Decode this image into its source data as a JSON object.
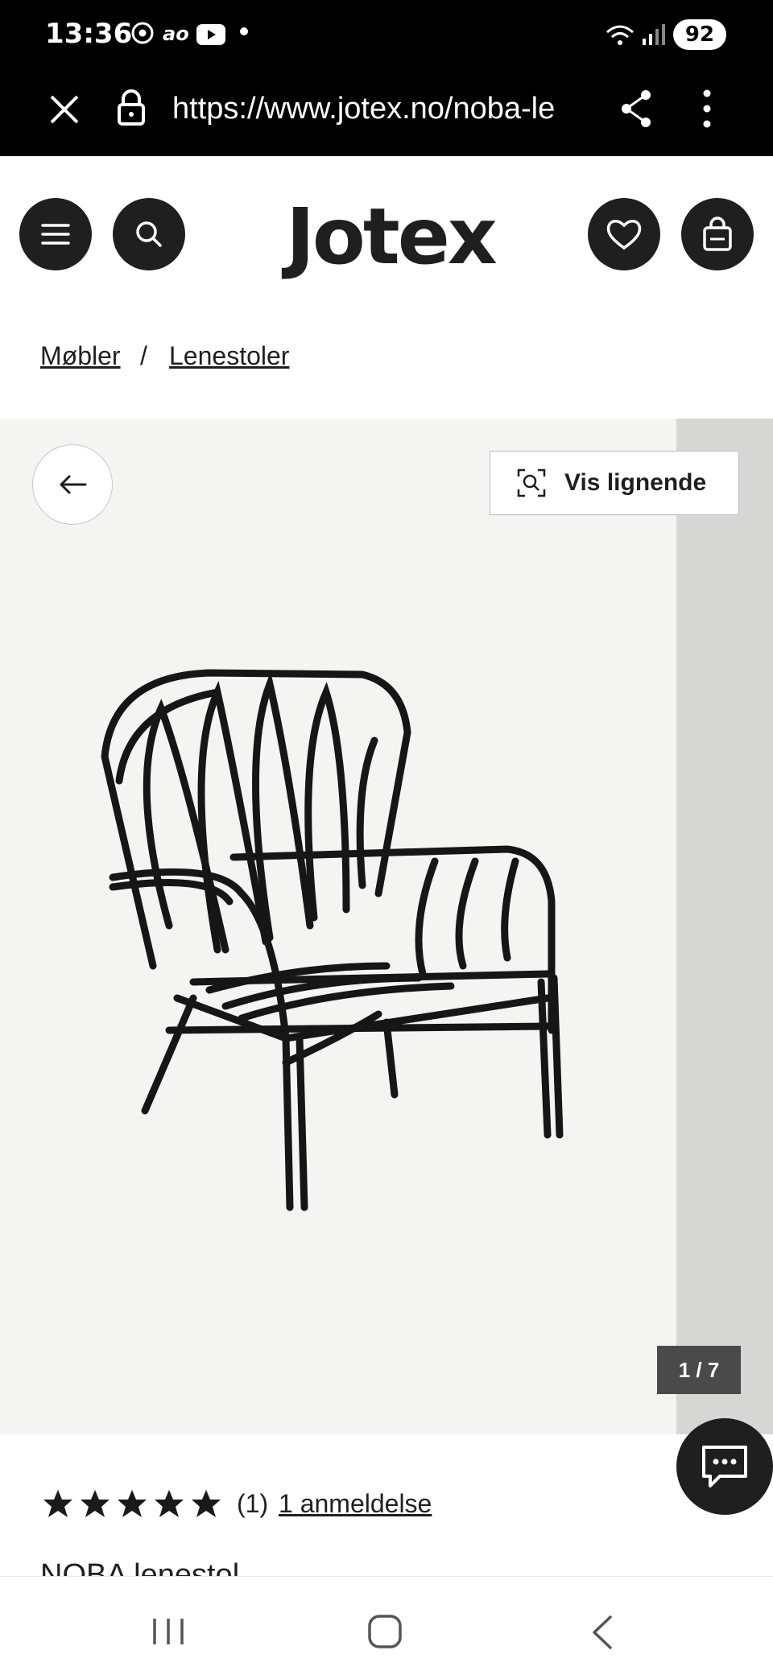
{
  "status_bar": {
    "time": "13:36",
    "battery": "92",
    "icons": [
      "chrome-icon",
      "ao-icon",
      "youtube-icon",
      "dot-icon",
      "wifi-icon",
      "signal-icon"
    ]
  },
  "browser": {
    "url": "https://www.jotex.no/noba-le"
  },
  "header": {
    "logo": "Jotex",
    "icons": [
      "menu-icon",
      "search-icon",
      "heart-icon",
      "bag-icon"
    ]
  },
  "breadcrumb": {
    "items": [
      {
        "label": "Møbler"
      },
      {
        "label": "Lenestoler"
      }
    ],
    "separator": "/"
  },
  "gallery": {
    "similar_label": "Vis lignende",
    "counter": "1 / 7"
  },
  "product": {
    "rating": 5,
    "rating_count": "(1)",
    "reviews_link": "1 anmeldelse",
    "title_partial": "NOBA lenestol"
  },
  "colors": {
    "dark": "#1f1f1f",
    "gallery_bg": "#f4f4f2",
    "next_image_bg": "#d6d6d4"
  }
}
